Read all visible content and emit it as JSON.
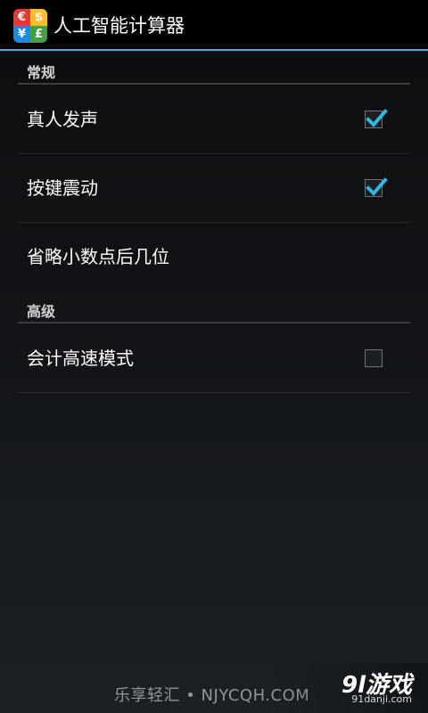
{
  "app": {
    "title": "人工智能计算器",
    "icon_glyphs": [
      "€",
      "$",
      "¥",
      "£"
    ]
  },
  "colors": {
    "accent": "#33b5e5",
    "actionbar_bg": "#000000",
    "divider": "#3a3d40"
  },
  "sections": [
    {
      "title": "常规",
      "items": [
        {
          "label": "真人发声",
          "checkbox": true,
          "checked": true
        },
        {
          "label": "按键震动",
          "checkbox": true,
          "checked": true
        },
        {
          "label": "省略小数点后几位",
          "checkbox": false
        }
      ]
    },
    {
      "title": "高级",
      "items": [
        {
          "label": "会计高速模式",
          "checkbox": true,
          "checked": false
        }
      ]
    }
  ],
  "watermark": {
    "left_text": "乐享轻汇 • NJYCQH.COM",
    "logo_text": "9l游戏",
    "url": "91danji.com"
  }
}
